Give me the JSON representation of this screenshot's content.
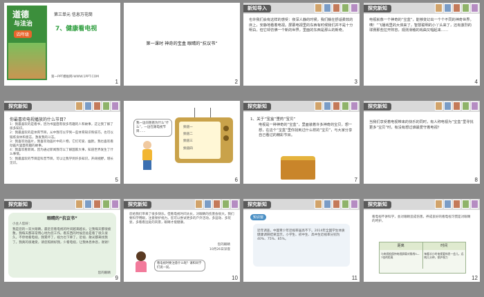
{
  "slides": [
    {
      "number": "1",
      "book_title_line1": "道德",
      "book_title_line2": "与法治",
      "grade_badge": "四年级",
      "unit": "第三单元 信息万花筒",
      "lesson": "7、健康看电视",
      "footer": "第一PPT模板网-WWW.1PPT.COM"
    },
    {
      "number": "2",
      "title": "第一课时 神奇的宝盒 眼睛的“抗议书”"
    },
    {
      "number": "3",
      "tag": "新知导入",
      "text": "也许我们会有这样的感受：夜深人静的时候，我们躺在舒适柔软的床上，安静地看着电视。屏幕电视里的东西有时候我们并不是十分明白，但它却仿佛一个新的世界，里面的东西是那么的新奇。"
    },
    {
      "number": "4",
      "tag": "探究新知",
      "text": "电视就像一个神奇的“宝盒”，能够变幻出一个个不同的神奇世界。咦！“飞播戏里的大侠来了，智慧聪明的小丫头来了，还有激烈的球赛那些拉开阵容，观测滑稽的戏曲又唱起来……"
    },
    {
      "number": "5",
      "tag": "探究新知",
      "question": "你最喜欢电视播放的什么节目？",
      "lines": [
        "1：我最喜欢的是看书，因为书里面有很多有趣的人和故事，这让我了解了很多知识。",
        "2：我最喜欢的是体育节目，从中我可以学到一些体育知识和技巧，也可以锻炼身体和意志，激发我的斗志。",
        "3：我喜欢动画片，我喜欢动画片中的人物，它们可爱、幽默。我也喜欢看动画片里面有趣的故事。",
        "4：我喜欢看新闻，因为通过新闻我可以了解国家大事，知道世界发生了什么事情。",
        "5：我最喜欢的节目是科普节目，可以让我学到许多知识，开阔视野，增长见识。"
      ]
    },
    {
      "number": "6",
      "bubble": "我一边问爸爸为什么“什么”，一边在跟电视节目……",
      "tv_lines": [
        "频道一",
        "频道二",
        "频道三",
        "频道四"
      ]
    },
    {
      "number": "7",
      "tag": "探究新知",
      "subtitle": "1、关于“宝盒”里的“宝贝”",
      "text": "电视是一种神奇的“宝盒”，里面装着许多神奇的宝贝，想一想，在这个“宝盒”里你找到过什么样的“宝贝”，与大家分享自己看过的精彩节目。"
    },
    {
      "number": "8",
      "tag": "探究新知",
      "text": "当我们享受着电视带来的快乐的同时，有人称电视为“宝盒”里寻找更多“宝贝”时，有没有想过谁最爱守着电视？"
    },
    {
      "number": "9",
      "tag": "探究新知",
      "card_title": "眼睛的“抗议书”",
      "greeting": "小主人您好：",
      "letter": "我是您的一双大眼睛，最近您看电视的时间越来越长，让我每天都很疲惫。我每天都非常用心地为您工作。看东西的时候您总是看了很久很久，不停地看电视，我累坏了，视力也下降了。近视、散光都来找我了。我真的很难受，请您照顾好我，少看电视，让我休息休息，谢谢！",
      "sign": "您的眼睛"
    },
    {
      "number": "10",
      "tag": "探究新知",
      "text": "您给我们带来了很多快乐，但看电视时间太长，对眼睛的伤害会很大。我们要科学用眼，注意保护视力。您可以尝试更多的户外活动，多运动、多玩耍，多看看远处的风景，眼睛才能健康。",
      "sign": "您的眼睛",
      "date": "10月26日深夜",
      "bubble": "看电视时要注意什么呢？请和同学们说一说。"
    },
    {
      "number": "11",
      "tag": "探究新知",
      "badge": "知识窗",
      "text": "近年调查，中国青少年近视率居高不下。2014年全国学生体质健康调研结果显示，小学生、初中生、高中生近视率分别为40%、75%、85%。"
    },
    {
      "number": "12",
      "tag": "探究新知",
      "text": "看电视不讲科学，会对眼睛造成伤害。养成良好的看电视习惯是对眼睛的呵护。",
      "table_headers": [
        "距离",
        "时间"
      ],
      "table_row": [
        "与电视机保持电视屏幕对角线5—7倍的距离",
        "每看半小时电视要休息一会儿，远眺几分钟，保护视力"
      ]
    }
  ],
  "colors": {
    "accent_green": "#2e9e3e",
    "header_gray": "#d9d9d9",
    "tag_dark": "#5a5a5a",
    "red": "#c0392b"
  }
}
